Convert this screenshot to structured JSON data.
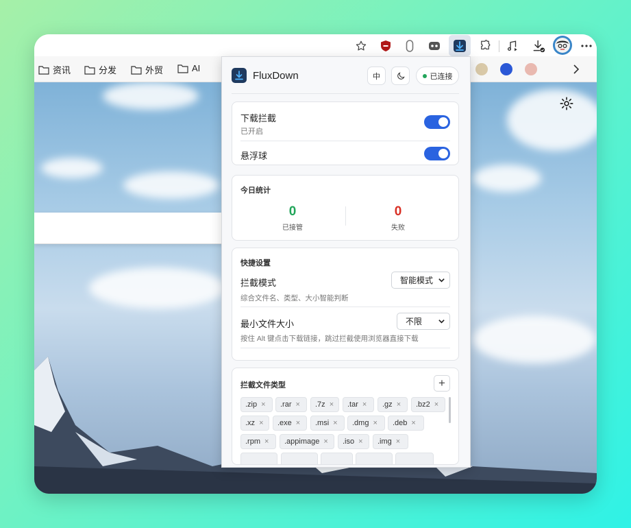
{
  "browser": {
    "toolbar_icons": [
      "star-icon",
      "shield-extension-icon",
      "mic-extension-icon",
      "game-extension-icon",
      "fluxdown-extension-icon",
      "puzzle-icon",
      "music-icon",
      "downloads-icon",
      "avatar-icon",
      "more-icon"
    ],
    "bookmarks": [
      {
        "label": "资讯"
      },
      {
        "label": "分发"
      },
      {
        "label": "外贸"
      },
      {
        "label": "AI"
      }
    ]
  },
  "popup": {
    "app_name": "FluxDown",
    "lang_button": "中",
    "status": "已连接",
    "intercept": {
      "label": "下载拦截",
      "status": "已开启",
      "on": true
    },
    "float_ball": {
      "label": "悬浮球",
      "on": true
    },
    "stats": {
      "title": "今日统计",
      "taken": {
        "value": "0",
        "label": "已接管"
      },
      "failed": {
        "value": "0",
        "label": "失败"
      }
    },
    "quick": {
      "title": "快捷设置",
      "mode_label": "拦截模式",
      "mode_value": "智能模式",
      "mode_hint": "综合文件名、类型、大小智能判断",
      "minsize_label": "最小文件大小",
      "minsize_value": "不限",
      "minsize_hint": "按住 Alt 键点击下载链接，跳过拦截使用浏览器直接下载"
    },
    "filetypes": {
      "title": "拦截文件类型",
      "tags": [
        ".zip",
        ".rar",
        ".7z",
        ".tar",
        ".gz",
        ".bz2",
        ".xz",
        ".exe",
        ".msi",
        ".dmg",
        ".deb",
        ".rpm",
        ".appimage",
        ".iso",
        ".img"
      ]
    }
  },
  "colors": {
    "accent": "#2a63e0",
    "success": "#22a55a",
    "danger": "#d93025"
  }
}
